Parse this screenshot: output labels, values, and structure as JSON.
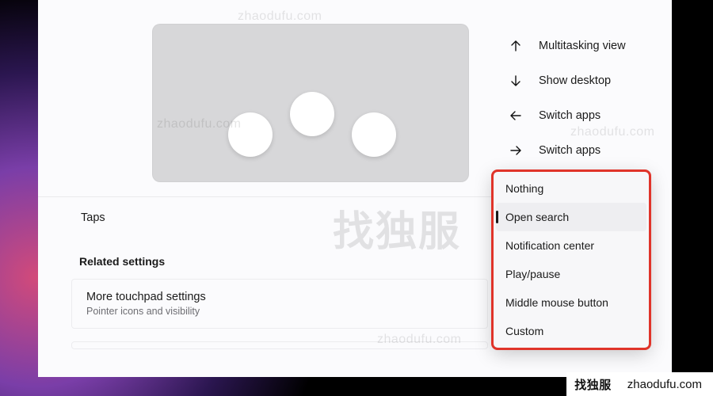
{
  "side_options": [
    {
      "icon": "arrow-up",
      "label": "Multitasking view"
    },
    {
      "icon": "arrow-down",
      "label": "Show desktop"
    },
    {
      "icon": "arrow-left",
      "label": "Switch apps"
    },
    {
      "icon": "arrow-right",
      "label": "Switch apps"
    }
  ],
  "dropdown": {
    "items": [
      "Nothing",
      "Open search",
      "Notification center",
      "Play/pause",
      "Middle mouse button",
      "Custom"
    ],
    "selected_index": 1
  },
  "taps_row": {
    "title": "Taps"
  },
  "related": {
    "heading": "Related settings",
    "more": {
      "title": "More touchpad settings",
      "sub": "Pointer icons and visibility"
    }
  },
  "watermarks": {
    "domain": "zhaodufu.com",
    "big": "找独服",
    "footer_bold": "找独服",
    "footer_domain": "zhaodufu.com"
  }
}
